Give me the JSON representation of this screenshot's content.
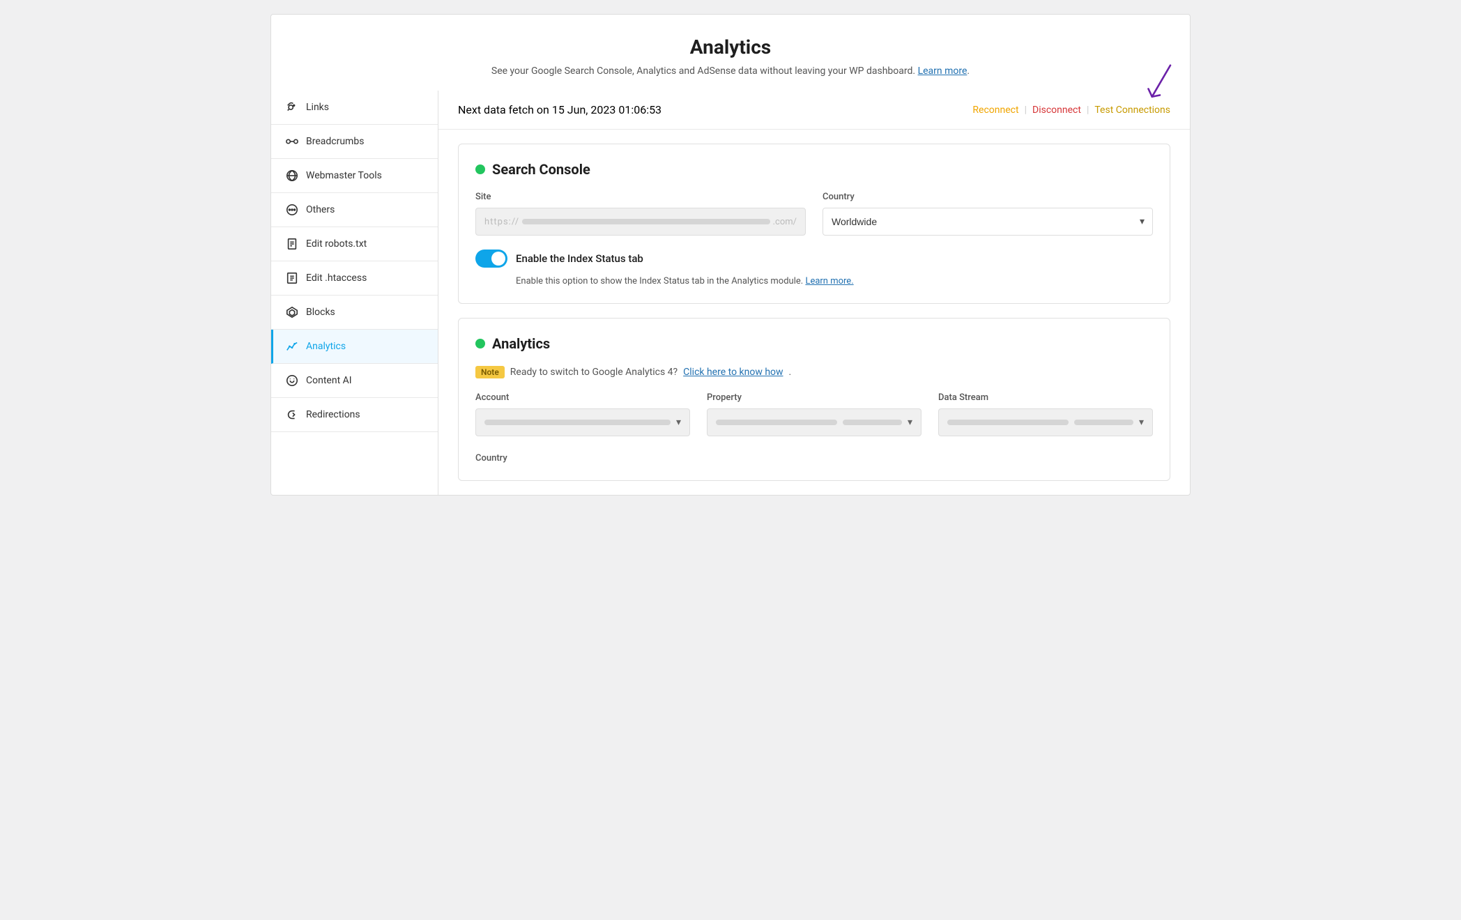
{
  "page": {
    "title": "Analytics",
    "subtitle": "See your Google Search Console, Analytics and AdSense data without leaving your WP dashboard.",
    "learn_more_label": "Learn more",
    "next_fetch_text": "Next data fetch on 15 Jun, 2023 01:06:53"
  },
  "header_actions": {
    "reconnect_label": "Reconnect",
    "disconnect_label": "Disconnect",
    "test_connections_label": "Test Connections"
  },
  "sidebar": {
    "items": [
      {
        "id": "links",
        "label": "Links",
        "icon": "links-icon"
      },
      {
        "id": "breadcrumbs",
        "label": "Breadcrumbs",
        "icon": "breadcrumbs-icon"
      },
      {
        "id": "webmaster-tools",
        "label": "Webmaster Tools",
        "icon": "webmaster-icon"
      },
      {
        "id": "others",
        "label": "Others",
        "icon": "others-icon"
      },
      {
        "id": "edit-robots",
        "label": "Edit robots.txt",
        "icon": "robots-icon"
      },
      {
        "id": "edit-htaccess",
        "label": "Edit .htaccess",
        "icon": "htaccess-icon"
      },
      {
        "id": "blocks",
        "label": "Blocks",
        "icon": "blocks-icon"
      },
      {
        "id": "analytics",
        "label": "Analytics",
        "icon": "analytics-icon",
        "active": true
      },
      {
        "id": "content-ai",
        "label": "Content AI",
        "icon": "content-ai-icon"
      },
      {
        "id": "redirections",
        "label": "Redirections",
        "icon": "redirections-icon"
      }
    ]
  },
  "search_console_section": {
    "title": "Search Console",
    "site_label": "Site",
    "site_placeholder": "https://                    .com/",
    "country_label": "Country",
    "country_value": "Worldwide",
    "toggle_label": "Enable the Index Status tab",
    "toggle_description": "Enable this option to show the Index Status tab in the Analytics module.",
    "toggle_learn_more": "Learn more."
  },
  "analytics_section": {
    "title": "Analytics",
    "note_label": "Note",
    "note_text": "Ready to switch to Google Analytics 4?",
    "note_link_label": "Click here to know how",
    "account_label": "Account",
    "property_label": "Property",
    "data_stream_label": "Data Stream",
    "country_label": "Country"
  }
}
